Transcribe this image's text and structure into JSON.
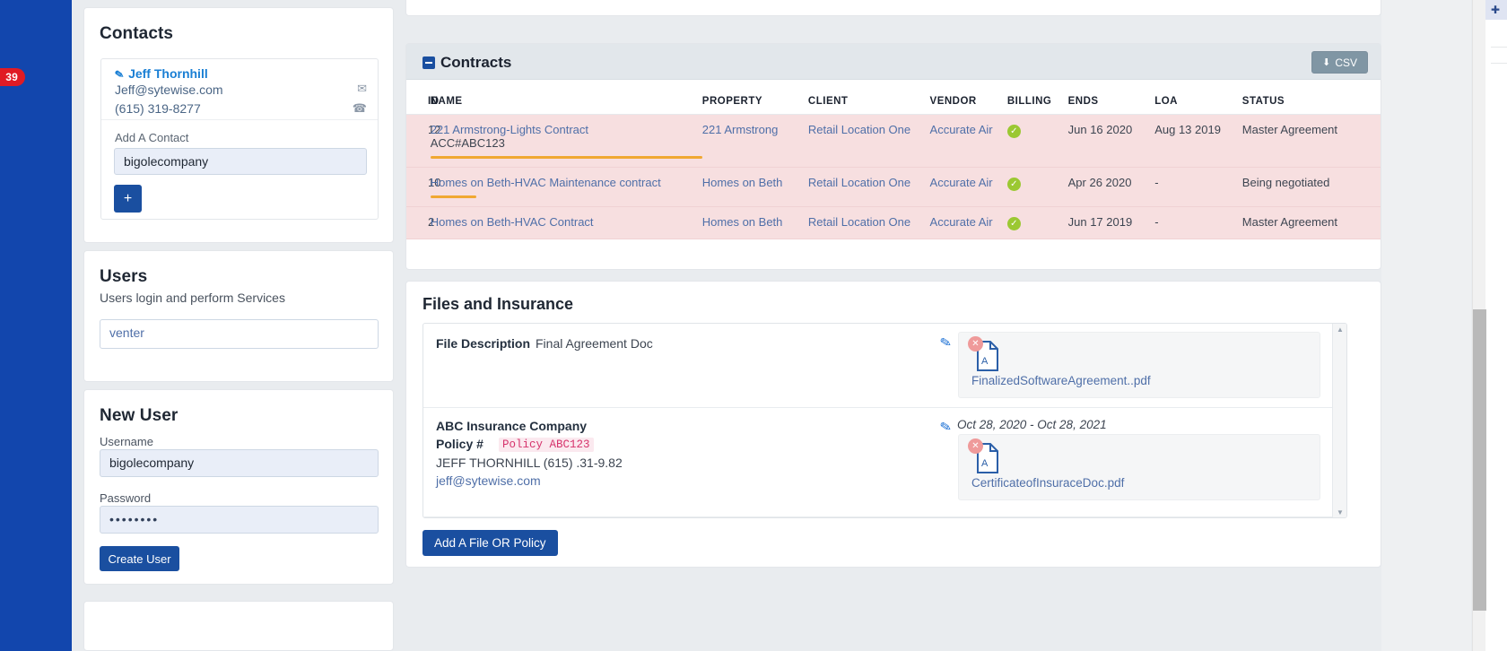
{
  "rail": {
    "badge_count": "39"
  },
  "contacts": {
    "title": "Contacts",
    "contact": {
      "name": "Jeff Thornhill",
      "email": "Jeff@sytewise.com",
      "phone": "(615) 319-8277",
      "edit_icon": "pencil-icon",
      "mail_icon": "envelope-icon",
      "phone_icon": "phone-icon"
    },
    "add_label": "Add A Contact",
    "add_value": "bigolecompany",
    "add_button": "+"
  },
  "users": {
    "title": "Users",
    "subtitle": "Users login and perform Services",
    "value": "venter"
  },
  "new_user": {
    "title": "New User",
    "username_label": "Username",
    "username_value": "bigolecompany",
    "password_label": "Password",
    "password_value": "••••••••",
    "create_button": "Create User"
  },
  "contracts": {
    "panel_title": "Contracts",
    "collapse_icon": "minus-box-icon",
    "csv_button": "CSV",
    "csv_icon": "download-icon",
    "columns": [
      "ID",
      "NAME",
      "PROPERTY",
      "CLIENT",
      "VENDOR",
      "BILLING",
      "ENDS",
      "LOA",
      "STATUS"
    ],
    "rows": [
      {
        "id": "12",
        "name": "221 Armstrong-Lights Contract",
        "name_sub": "ACC#ABC123",
        "progress_pct": 100,
        "property": "221 Armstrong",
        "client": "Retail Location One",
        "vendor": "Accurate Air",
        "billing_icon": "check-circle-icon",
        "ends": "Jun 16 2020",
        "loa": "Aug 13 2019",
        "status": "Master Agreement"
      },
      {
        "id": "10",
        "name": "Homes on Beth-HVAC Maintenance contract",
        "name_sub": "",
        "progress_pct": 17,
        "property": "Homes on Beth",
        "client": "Retail Location One",
        "vendor": "Accurate Air",
        "billing_icon": "check-circle-icon",
        "ends": "Apr 26 2020",
        "loa": "-",
        "status": "Being negotiated"
      },
      {
        "id": "2",
        "name": "Homes on Beth-HVAC Contract",
        "name_sub": "",
        "progress_pct": 0,
        "property": "Homes on Beth",
        "client": "Retail Location One",
        "vendor": "Accurate Air",
        "billing_icon": "check-circle-icon",
        "ends": "Jun 17 2019",
        "loa": "-",
        "status": "Master Agreement"
      }
    ]
  },
  "files": {
    "title": "Files and Insurance",
    "file_row": {
      "label": "File Description",
      "value": "Final Agreement Doc",
      "edit_icon": "pencil-icon",
      "delete_icon": "remove-circle-icon",
      "file_icon": "pdf-file-icon",
      "file_name": "FinalizedSoftwareAgreement..pdf"
    },
    "policy_row": {
      "company": "ABC Insurance Company",
      "policy_label": "Policy #",
      "policy_number": "Policy ABC123",
      "contact": "JEFF THORNHILL (615) .31-9.82",
      "email": "jeff@sytewise.com",
      "date_range": "Oct 28, 2020 - Oct 28, 2021",
      "edit_icon": "pencil-icon",
      "delete_icon": "remove-circle-icon",
      "file_icon": "pdf-file-icon",
      "file_name": "CertificateofInsuraceDoc.pdf"
    },
    "add_button": "Add A File OR Policy"
  },
  "colors": {
    "brand_blue": "#1a4fa0",
    "rail_blue": "#1246ad",
    "badge_red": "#e01b24",
    "row_pink": "#f7dfe0",
    "progress_orange": "#f0a832",
    "check_green": "#9bc832",
    "link_blue": "#4f6fa8",
    "csv_gray": "#8096a4"
  }
}
